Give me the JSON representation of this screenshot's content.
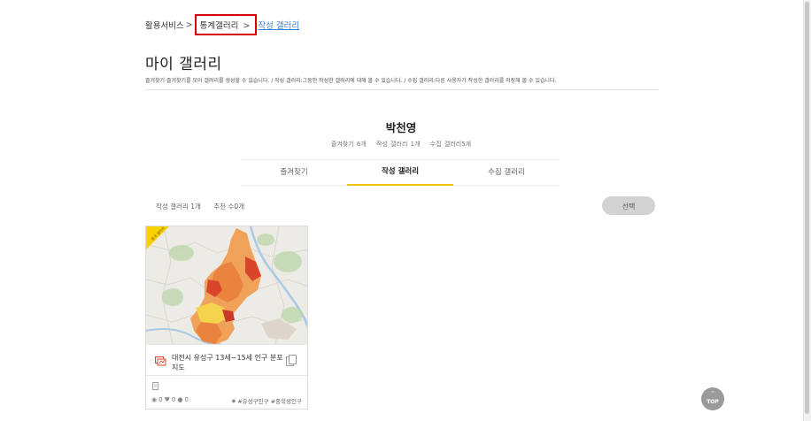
{
  "breadcrumb": {
    "item1": "활용서비스",
    "item2": "통계갤러리",
    "item3": "작성 갤러리",
    "sep": ">"
  },
  "page": {
    "title": "마이 갤러리",
    "description": "즐겨찾기·즐겨찾기를 모아 갤러리를 생성할 수 있습니다. / 작성 갤러리:그동안 작성한 갤러리에 대해 볼 수 있습니다. / 수집 갤러리:다른 사용자가 작성한 갤러리를 저장해 볼 수 있습니다."
  },
  "user": {
    "name": "박천영",
    "favorites": "즐겨찾기 6개",
    "written": "작성 갤러리 1개",
    "collected": "수집 갤러리5개"
  },
  "tabs": [
    {
      "label": "즐겨찾기",
      "active": false
    },
    {
      "label": "작성 갤러리",
      "active": true
    },
    {
      "label": "수집 갤러리",
      "active": false
    }
  ],
  "counts": {
    "written": "작성 갤러리 1개",
    "recommend": "추천 수0개"
  },
  "select_button": "선택",
  "card": {
    "ribbon": "통계 갤러리",
    "title": "대전시 유성구 13세~15세 인구 분포 지도",
    "views": "0",
    "likes": "0",
    "comments": "0",
    "tags": "#유성구인구 #중학생인구"
  },
  "top_button": "TOP",
  "colors": {
    "highlight_border": "#d40000",
    "link": "#3a7bd5",
    "tab_active": "#f2c200",
    "map_dark": "#d9452b",
    "map_mid": "#e9833e",
    "map_light": "#f1a25a",
    "map_yellow": "#f6d34c"
  }
}
